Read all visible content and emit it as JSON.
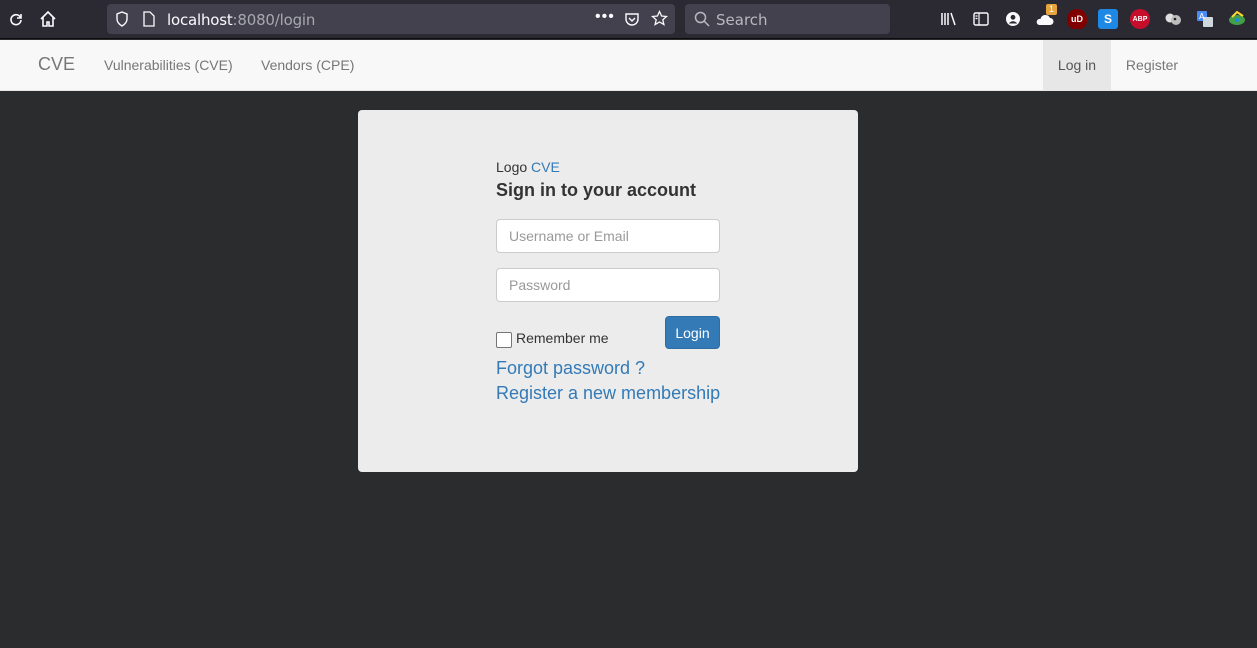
{
  "browser": {
    "url_host": "localhost",
    "url_rest": ":8080/login",
    "search_placeholder": "Search",
    "badge_count": "1",
    "ext_ublock": "uD",
    "ext_s": "S",
    "ext_abp": "ABP"
  },
  "navbar": {
    "brand": "CVE",
    "links": [
      "Vulnerabilities (CVE)",
      "Vendors (CPE)"
    ],
    "login": "Log in",
    "register": "Register"
  },
  "login": {
    "logo_text": "Logo",
    "logo_brand": "CVE",
    "title": "Sign in to your account",
    "username_placeholder": "Username or Email",
    "password_placeholder": "Password",
    "remember_label": "Remember me",
    "submit_label": "Login",
    "forgot_link": "Forgot password ?",
    "register_link": "Register a new membership"
  },
  "colors": {
    "page_bg": "#2b2c2e",
    "card_bg": "#ececec",
    "primary": "#337ab7"
  }
}
